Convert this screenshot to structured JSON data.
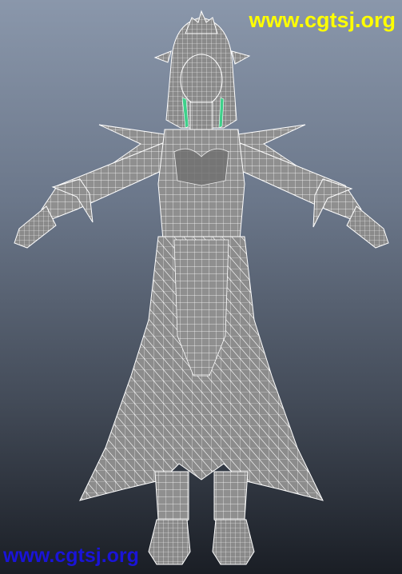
{
  "viewport": {
    "background_top": "#8a97ab",
    "background_bottom": "#1a1e25",
    "mesh_fill": "#8f8f8f",
    "mesh_shadow": "#6f6f6f",
    "wire_color": "#ffffff",
    "accent_color": "#3ed08a",
    "model_name": "wireframe-character-mesh"
  },
  "watermarks": {
    "top_text": "www.cgtsj.org",
    "top_color": "#ffff00",
    "bottom_text": "www.cgtsj.org",
    "bottom_color": "#1a14d8"
  }
}
